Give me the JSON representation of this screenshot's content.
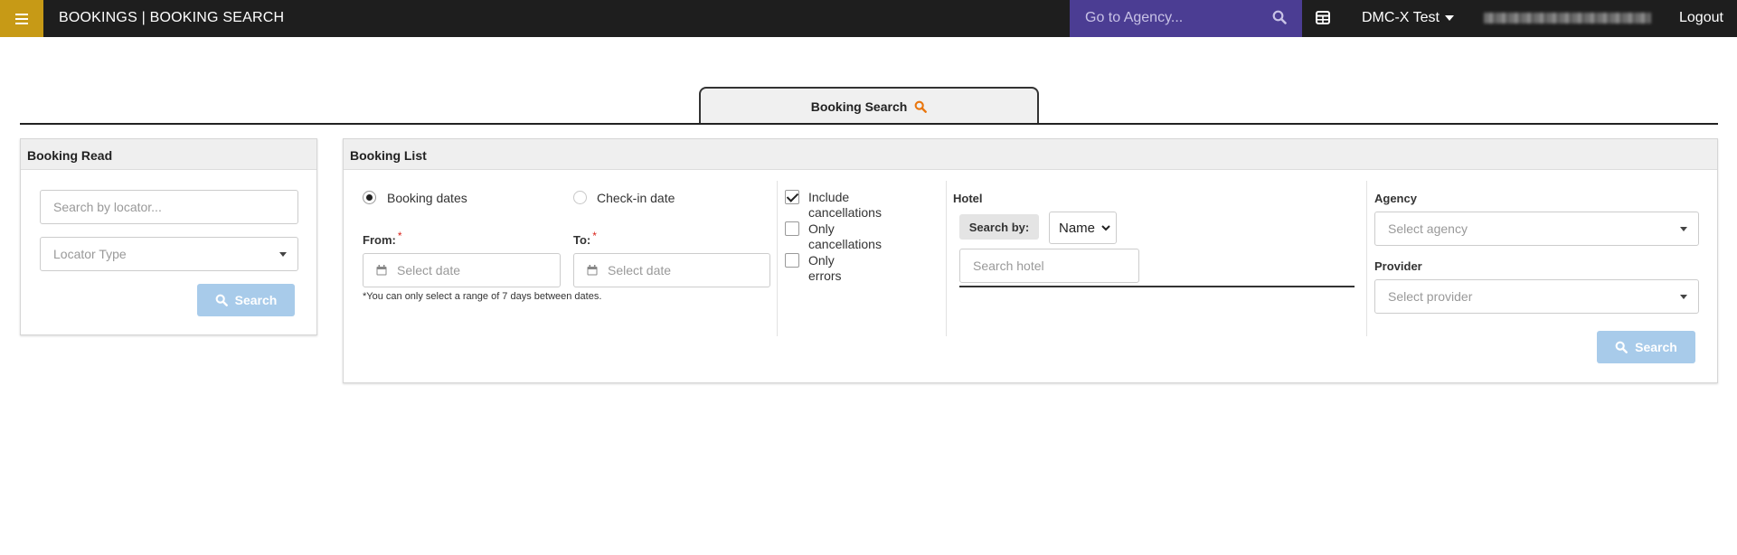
{
  "topbar": {
    "title": "BOOKINGS | BOOKING SEARCH",
    "agency_search_placeholder": "Go to Agency...",
    "environment": "DMC-X Test",
    "logout": "Logout",
    "brand_color": "#c79a16",
    "search_color": "#4b3d93"
  },
  "tab": {
    "label": "Booking Search"
  },
  "booking_read": {
    "title": "Booking Read",
    "locator_placeholder": "Search by locator...",
    "locator_type_placeholder": "Locator Type",
    "search_button": "Search"
  },
  "booking_list": {
    "title": "Booking List",
    "date_mode": {
      "options": [
        "Booking dates",
        "Check-in date"
      ],
      "selected": "Booking dates"
    },
    "from_label": "From:",
    "to_label": "To:",
    "required_mark": "*",
    "from_placeholder": "Select date",
    "to_placeholder": "Select date",
    "range_note": "*You can only select a range of 7 days between dates.",
    "checkboxes": [
      {
        "line1": "Include",
        "line2": "cancellations",
        "checked": true
      },
      {
        "line1": "Only",
        "line2": "cancellations",
        "checked": false
      },
      {
        "line1": "Only",
        "line2": "errors",
        "checked": false
      }
    ],
    "hotel_label": "Hotel",
    "search_by_label": "Search by:",
    "search_by_value": "Name",
    "hotel_placeholder": "Search hotel",
    "agency_label": "Agency",
    "agency_placeholder": "Select agency",
    "provider_label": "Provider",
    "provider_placeholder": "Select provider",
    "search_button": "Search"
  }
}
